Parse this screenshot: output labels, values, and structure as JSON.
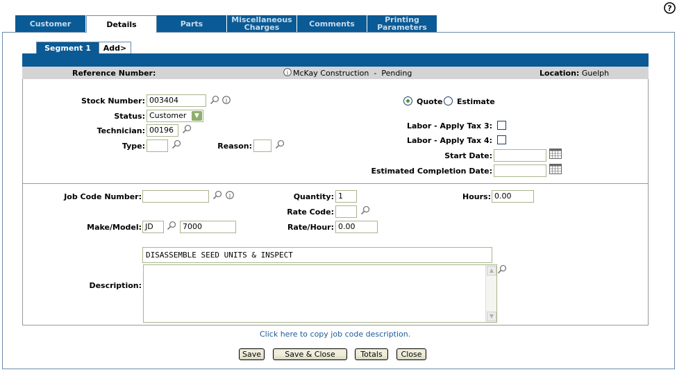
{
  "help_icon": "question-circle-icon",
  "tabs": [
    {
      "label": "Customer"
    },
    {
      "label": "Details"
    },
    {
      "label": "Parts"
    },
    {
      "label": "Miscellaneous Charges"
    },
    {
      "label": "Comments"
    },
    {
      "label": "Printing Parameters"
    }
  ],
  "segments": {
    "active": "Segment 1",
    "add": "Add>"
  },
  "info_bar": {
    "reference_label": "Reference Number:",
    "customer": "McKay Construction",
    "separator": "-",
    "status": "Pending",
    "location_label": "Location:",
    "location": "Guelph"
  },
  "form": {
    "stock_number": {
      "label": "Stock Number:",
      "value": "003404"
    },
    "status": {
      "label": "Status:",
      "value": "Customer"
    },
    "technician": {
      "label": "Technician:",
      "value": "00196"
    },
    "type": {
      "label": "Type:",
      "value": ""
    },
    "reason": {
      "label": "Reason:",
      "value": ""
    },
    "quote_label": "Quote",
    "estimate_label": "Estimate",
    "selected_mode": "Quote",
    "labor_tax3": {
      "label": "Labor - Apply Tax 3:",
      "checked": false
    },
    "labor_tax4": {
      "label": "Labor - Apply Tax 4:",
      "checked": false
    },
    "start_date": {
      "label": "Start Date:",
      "value": ""
    },
    "est_completion": {
      "label": "Estimated Completion Date:",
      "value": ""
    }
  },
  "job": {
    "job_code": {
      "label": "Job Code Number:",
      "value": ""
    },
    "quantity": {
      "label": "Quantity:",
      "value": "1"
    },
    "hours": {
      "label": "Hours:",
      "value": "0.00"
    },
    "rate_code": {
      "label": "Rate Code:",
      "value": ""
    },
    "make_model": {
      "label": "Make/Model:",
      "make": "JD",
      "model": "7000"
    },
    "rate_hour": {
      "label": "Rate/Hour:",
      "value": "0.00"
    },
    "description_label": "Description:",
    "description_line": "DISASSEMBLE SEED UNITS & INSPECT",
    "description_text": ""
  },
  "copy_link": "Click here to copy job code description.",
  "buttons": {
    "save": "Save",
    "save_close": "Save & Close",
    "totals": "Totals",
    "close": "Close"
  }
}
